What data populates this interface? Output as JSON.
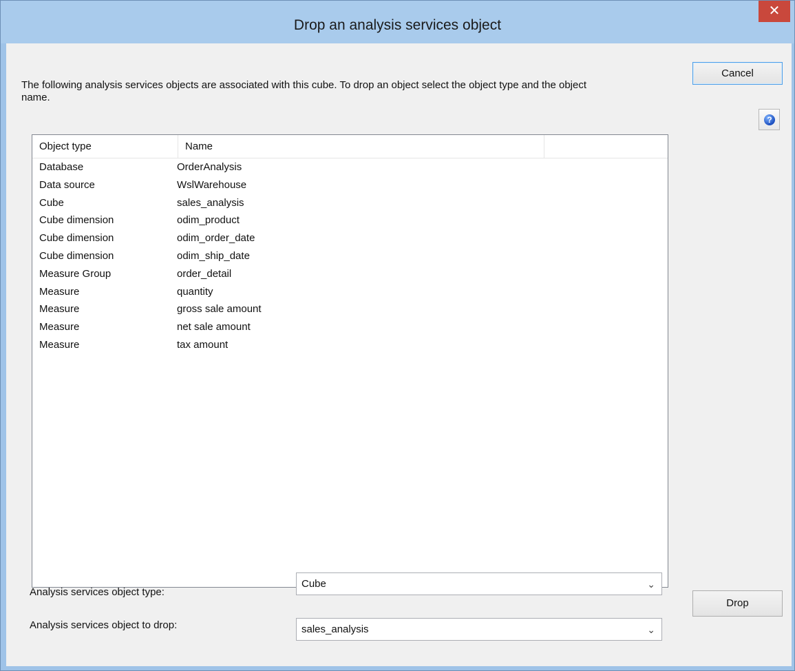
{
  "window": {
    "title": "Drop an analysis services object",
    "close_glyph": "✕"
  },
  "description": "The following analysis services objects are associated with this cube. To drop an object select the object type and the object name.",
  "buttons": {
    "cancel_label": "Cancel",
    "drop_label": "Drop",
    "help_glyph": "?"
  },
  "list": {
    "columns": [
      "Object type",
      "Name",
      ""
    ],
    "rows": [
      {
        "type": "Database",
        "name": "OrderAnalysis"
      },
      {
        "type": "Data source",
        "name": "WslWarehouse"
      },
      {
        "type": "Cube",
        "name": "sales_analysis"
      },
      {
        "type": "Cube dimension",
        "name": "odim_product"
      },
      {
        "type": "Cube dimension",
        "name": "odim_order_date"
      },
      {
        "type": "Cube dimension",
        "name": "odim_ship_date"
      },
      {
        "type": "Measure Group",
        "name": "order_detail"
      },
      {
        "type": "Measure",
        "name": "quantity"
      },
      {
        "type": "Measure",
        "name": "gross sale amount"
      },
      {
        "type": "Measure",
        "name": "net sale amount"
      },
      {
        "type": "Measure",
        "name": "tax amount"
      }
    ]
  },
  "form": {
    "object_type_label": "Analysis services object type:",
    "object_type_value": "Cube",
    "object_drop_label": "Analysis services object to drop:",
    "object_drop_value": "sales_analysis",
    "chevron_glyph": "⌄"
  },
  "icons": {
    "help": "help-icon",
    "close": "close-icon",
    "dropdown": "chevron-down-icon"
  }
}
